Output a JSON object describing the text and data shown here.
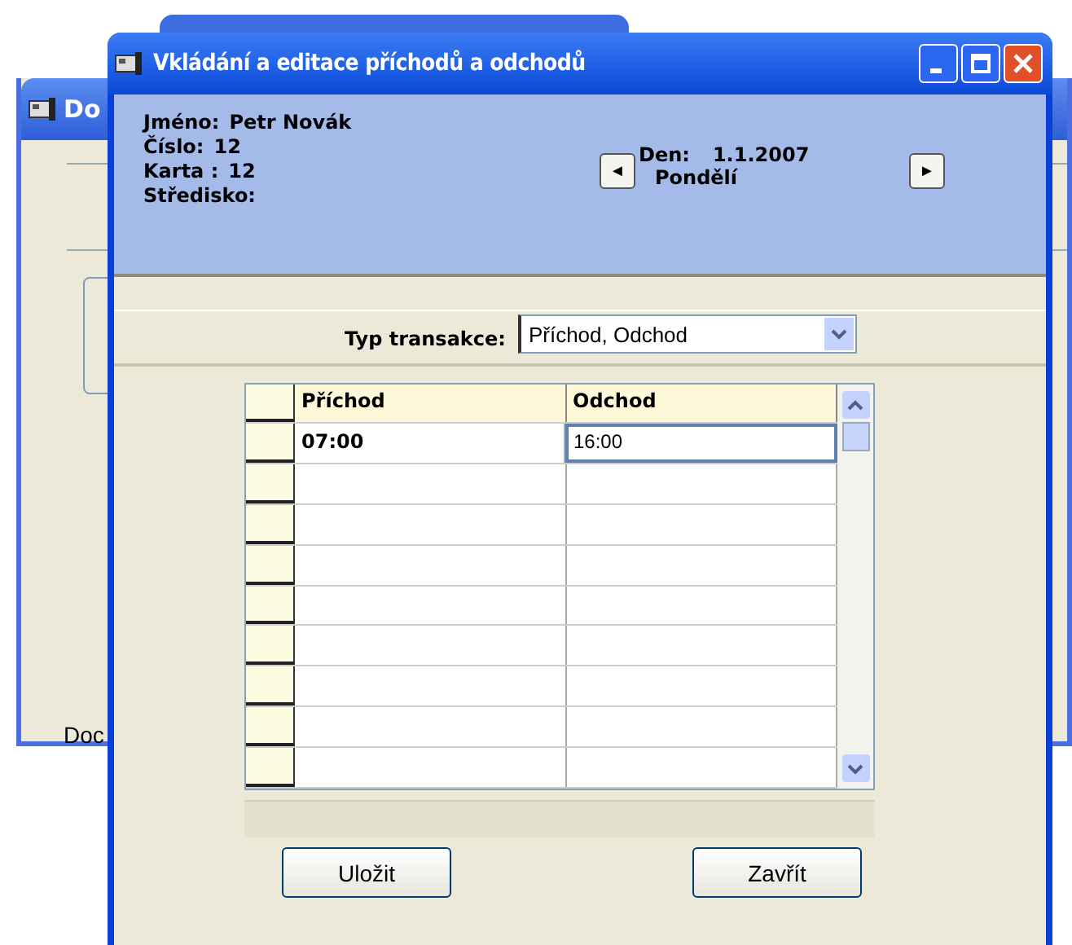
{
  "background_window": {
    "title": "Do",
    "status": "Doc"
  },
  "dialog": {
    "title": "Vkládání a editace příchodů a odchodů",
    "info": [
      {
        "label": "Jméno:",
        "value": "Petr Novák"
      },
      {
        "label": "Číslo:",
        "value": "12"
      },
      {
        "label": "Karta :",
        "value": "12"
      },
      {
        "label": "Středisko:"
      }
    ],
    "day": {
      "prev": "◄",
      "label": "Den:",
      "date": "1.1.2007",
      "weekday": "Pondělí",
      "next": "►"
    },
    "transaction_type": {
      "label": "Typ transakce:",
      "value": "Příchod, Odchod"
    },
    "table": {
      "columns": [
        "Příchod",
        "Odchod"
      ],
      "rows": [
        {
          "cells": [
            {
              "text": "07:00",
              "editing": false
            },
            {
              "text": "16:00",
              "editing": true
            }
          ]
        }
      ]
    },
    "buttons": [
      "Uložit",
      "Zavřít"
    ]
  }
}
